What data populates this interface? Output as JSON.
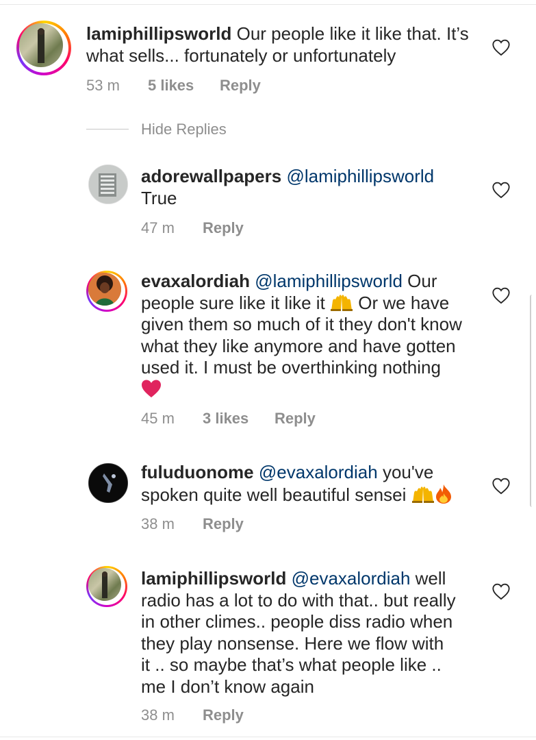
{
  "comments": [
    {
      "username": "lamiphillipsworld",
      "mention": "",
      "text_lines": [
        "Our people like it like that. It’s",
        "what sells... fortunately or unfortunately"
      ],
      "time": "53 m",
      "likes": "5 likes",
      "reply": "Reply"
    }
  ],
  "hide_replies": "Hide Replies",
  "replies": [
    {
      "username": "adorewallpapers",
      "mention": "@lamiphillipsworld",
      "text_lines": [
        "True"
      ],
      "time": "47 m",
      "likes": "",
      "reply": "Reply"
    },
    {
      "username": "evaxalordiah",
      "mention": "@lamiphillipsworld",
      "line1_tail": "Our",
      "line2_head": "people sure like it like it",
      "line2_tail": "Or we have",
      "line3": "given them so much of it they don't know",
      "line4": "what they like anymore and have gotten",
      "line5": "used it. I must be overthinking nothing",
      "time": "45 m",
      "likes": "3 likes",
      "reply": "Reply"
    },
    {
      "username": "fuluduonome",
      "mention": "@evaxalordiah",
      "line1_tail": "you've",
      "line2": "spoken quite well beautiful sensei",
      "time": "38 m",
      "likes": "",
      "reply": "Reply"
    },
    {
      "username": "lamiphillipsworld",
      "mention": "@evaxalordiah",
      "line1_tail": "well",
      "line2": "radio has a lot to do with that.. but really",
      "line3": "in other climes.. people diss radio when",
      "line4": "they play nonsense. Here we flow with",
      "line5": "it .. so maybe that’s what people like ..",
      "line6": "me I don’t know again",
      "time": "38 m",
      "likes": "",
      "reply": "Reply"
    }
  ],
  "icons": {
    "like": "heart-outline-icon",
    "emoji_heart": "red-heart-emoji",
    "emoji_hands": "raising-hands-emoji",
    "emoji_fire": "fire-emoji"
  },
  "colors": {
    "text": "#262626",
    "muted": "#8e8e8e",
    "mention": "#00376b",
    "heart_emoji": "#e0245e"
  }
}
